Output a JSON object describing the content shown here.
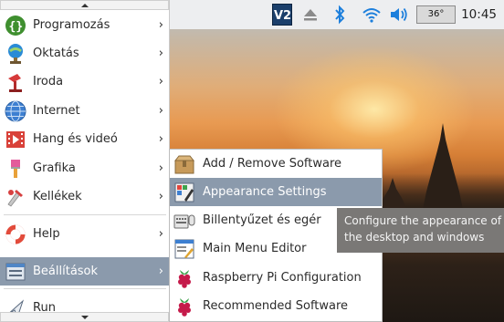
{
  "panel": {
    "clock": "10:45",
    "temperature": "36°",
    "icons": [
      "vnc-icon",
      "eject-icon",
      "bluetooth-icon",
      "wifi-icon",
      "volume-icon"
    ]
  },
  "menu": {
    "items": [
      {
        "label": "Programozás",
        "icon": "programming-icon",
        "has_submenu": true
      },
      {
        "label": "Oktatás",
        "icon": "education-icon",
        "has_submenu": true
      },
      {
        "label": "Iroda",
        "icon": "office-icon",
        "has_submenu": true
      },
      {
        "label": "Internet",
        "icon": "internet-icon",
        "has_submenu": true
      },
      {
        "label": "Hang és videó",
        "icon": "sound-video-icon",
        "has_submenu": true
      },
      {
        "label": "Grafika",
        "icon": "graphics-icon",
        "has_submenu": true
      },
      {
        "label": "Kellékek",
        "icon": "accessories-icon",
        "has_submenu": true
      },
      {
        "label": "Help",
        "icon": "help-icon",
        "has_submenu": true
      },
      {
        "label": "Beállítások",
        "icon": "preferences-icon",
        "has_submenu": true,
        "active": true
      },
      {
        "label": "Run",
        "icon": "run-icon",
        "has_submenu": false
      }
    ]
  },
  "submenu": {
    "items": [
      {
        "label": "Add / Remove Software",
        "icon": "package-icon"
      },
      {
        "label": "Appearance Settings",
        "icon": "appearance-icon",
        "active": true
      },
      {
        "label": "Billentyűzet és egér",
        "icon": "keyboard-mouse-icon"
      },
      {
        "label": "Main Menu Editor",
        "icon": "menu-editor-icon"
      },
      {
        "label": "Raspberry Pi Configuration",
        "icon": "raspberry-icon"
      },
      {
        "label": "Recommended Software",
        "icon": "raspberry-icon"
      }
    ]
  },
  "tooltip": {
    "line1": "Configure the appearance of",
    "line2": "the desktop and windows"
  },
  "colors": {
    "highlight": "#8b9aac",
    "tooltip_bg": "#7a7876",
    "panel_bg": "#edeef0",
    "accent_blue": "#1d7fdc"
  }
}
